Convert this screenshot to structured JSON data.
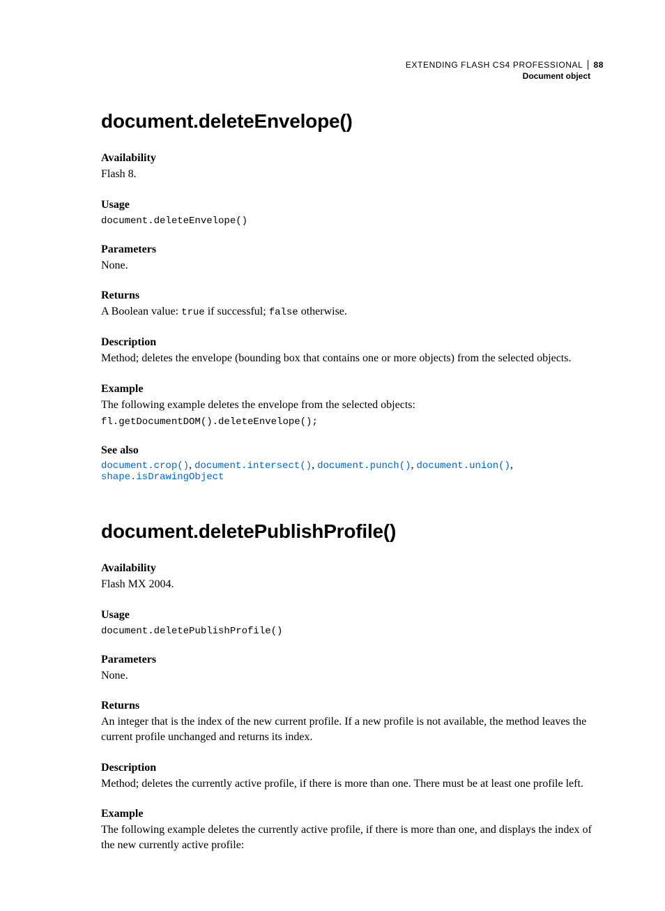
{
  "header": {
    "book_title": "EXTENDING FLASH CS4 PROFESSIONAL",
    "page_number": "88",
    "chapter": "Document object"
  },
  "s1": {
    "title": "document.deleteEnvelope()",
    "availability_label": "Availability",
    "availability_text": "Flash 8.",
    "usage_label": "Usage",
    "usage_code": "document.deleteEnvelope()",
    "parameters_label": "Parameters",
    "parameters_text": "None.",
    "returns_label": "Returns",
    "returns_prefix": "A Boolean value: ",
    "returns_true": "true",
    "returns_mid": " if successful; ",
    "returns_false": "false",
    "returns_suffix": " otherwise.",
    "description_label": "Description",
    "description_text": "Method; deletes the envelope (bounding box that contains one or more objects) from the selected objects.",
    "example_label": "Example",
    "example_text": "The following example deletes the envelope from the selected objects:",
    "example_code": "fl.getDocumentDOM().deleteEnvelope();",
    "seealso_label": "See also",
    "seealso": [
      "document.crop()",
      "document.intersect()",
      "document.punch()",
      "document.union()",
      "shape.isDrawingObject"
    ]
  },
  "s2": {
    "title": "document.deletePublishProfile()",
    "availability_label": "Availability",
    "availability_text": "Flash MX 2004.",
    "usage_label": "Usage",
    "usage_code": "document.deletePublishProfile()",
    "parameters_label": "Parameters",
    "parameters_text": "None.",
    "returns_label": "Returns",
    "returns_text": "An integer that is the index of the new current profile. If a new profile is not available, the method leaves the current profile unchanged and returns its index.",
    "description_label": "Description",
    "description_text": "Method; deletes the currently active profile, if there is more than one. There must be at least one profile left.",
    "example_label": "Example",
    "example_text": "The following example deletes the currently active profile, if there is more than one, and displays the index of the new currently active profile:"
  }
}
